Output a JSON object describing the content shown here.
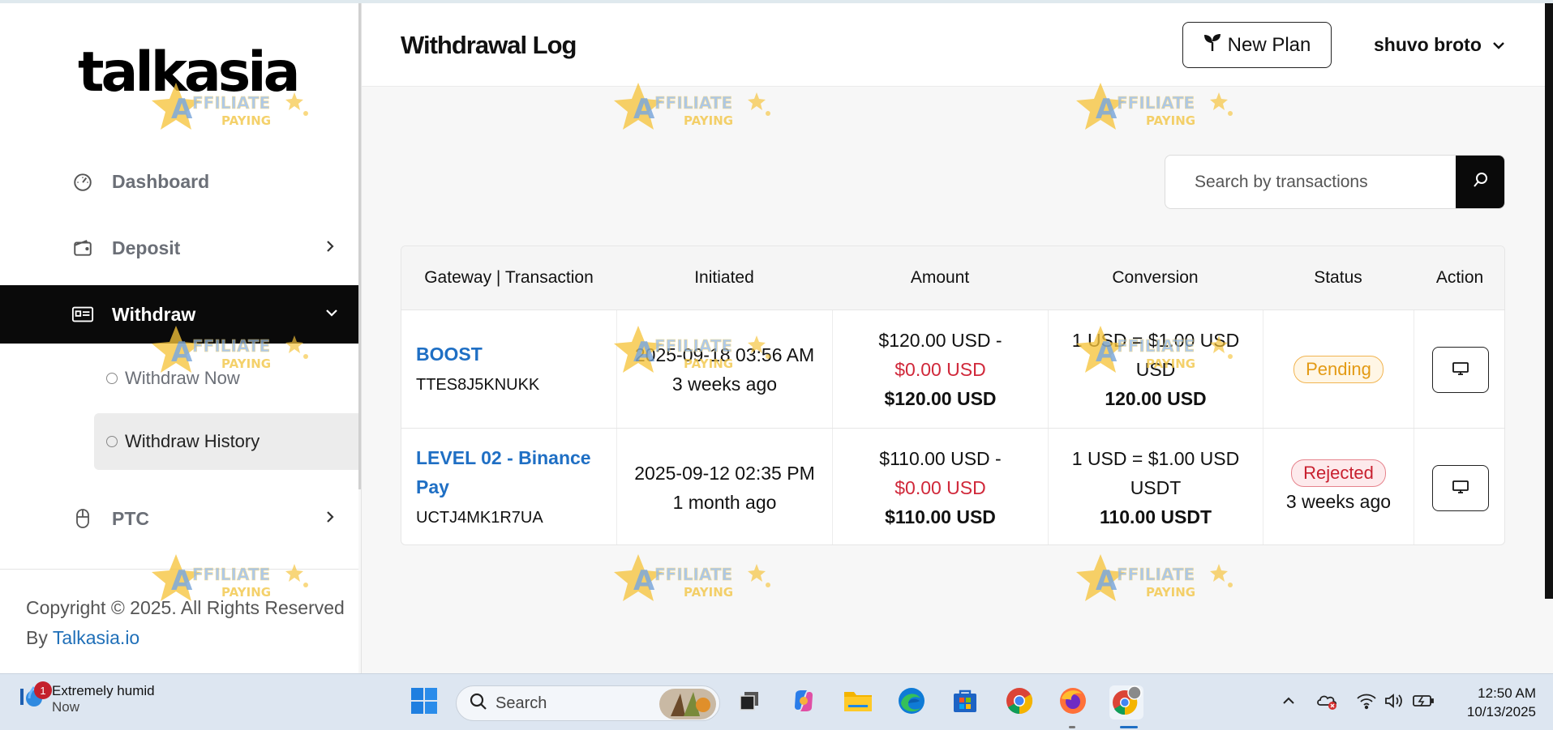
{
  "brand": {
    "logo_text": "talkasia"
  },
  "sidebar": {
    "items": [
      {
        "label": "Dashboard",
        "icon": "gauge-icon"
      },
      {
        "label": "Deposit",
        "icon": "wallet-icon"
      },
      {
        "label": "Withdraw",
        "icon": "card-icon",
        "active": true
      },
      {
        "label": "PTC",
        "icon": "mouse-icon"
      }
    ],
    "withdraw_sub": [
      {
        "label": "Withdraw Now"
      },
      {
        "label": "Withdraw History",
        "active": true
      }
    ],
    "copyright_text": "Copyright © 2025. All Rights Reserved By ",
    "copyright_link": "Talkasia.io"
  },
  "header": {
    "title": "Withdrawal Log",
    "new_plan_label": "New Plan",
    "user_name": "shuvo broto"
  },
  "search": {
    "placeholder": "Search by transactions"
  },
  "table": {
    "columns": [
      "Gateway | Transaction",
      "Initiated",
      "Amount",
      "Conversion",
      "Status",
      "Action"
    ],
    "rows": [
      {
        "gateway": "BOOST",
        "trx": "TTES8J5KNUKK",
        "initiated": "2025-09-18 03:56 AM",
        "initiated_ago": "3 weeks ago",
        "amount_line": "$120.00 USD -",
        "charge": "$0.00 USD",
        "amount_total": "$120.00 USD",
        "conversion": "1 USD = $1.00 USD USD",
        "converted": "120.00 USD",
        "status": "Pending",
        "status_time": ""
      },
      {
        "gateway": "LEVEL 02 - Binance Pay",
        "trx": "UCTJ4MK1R7UA",
        "initiated": "2025-09-12 02:35 PM",
        "initiated_ago": "1 month ago",
        "amount_line": "$110.00 USD -",
        "charge": "$0.00 USD",
        "amount_total": "$110.00 USD",
        "conversion": "1 USD = $1.00 USD USDT",
        "converted": "110.00 USDT",
        "status": "Rejected",
        "status_time": "3 weeks ago"
      }
    ]
  },
  "watermark": {
    "line1": "AFFILIATE",
    "line2": "PAYING"
  },
  "taskbar": {
    "weather_text": "Extremely humid",
    "weather_sub": "Now",
    "notification_count": "1",
    "search_label": "Search",
    "time": "12:50 AM",
    "date": "10/13/2025"
  },
  "colors": {
    "accent_blue": "#1f6fc4",
    "pending": "#e39a14",
    "rejected": "#c8202f",
    "sidebar_active": "#0a0a0a"
  }
}
